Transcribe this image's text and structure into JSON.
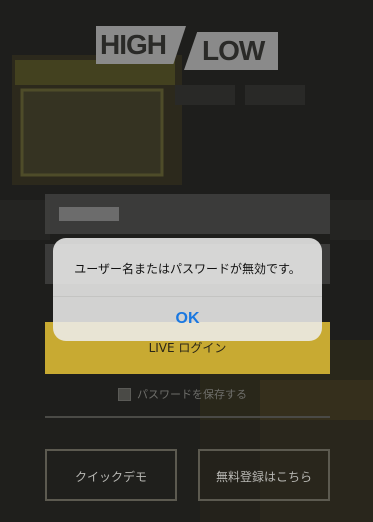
{
  "logo": {
    "left": "HIGH",
    "right": "LOW"
  },
  "login_form": {
    "login_button": "LIVE ログイン",
    "save_password_label": "パスワードを保存する",
    "demo_button": "クイックデモ",
    "register_button": "無料登録はこちら"
  },
  "alert": {
    "message": "ユーザー名またはパスワードが無効です。",
    "ok_label": "OK"
  },
  "colors": {
    "accent_yellow": "#c8aa32",
    "alert_ok_blue": "#1a78e0"
  }
}
